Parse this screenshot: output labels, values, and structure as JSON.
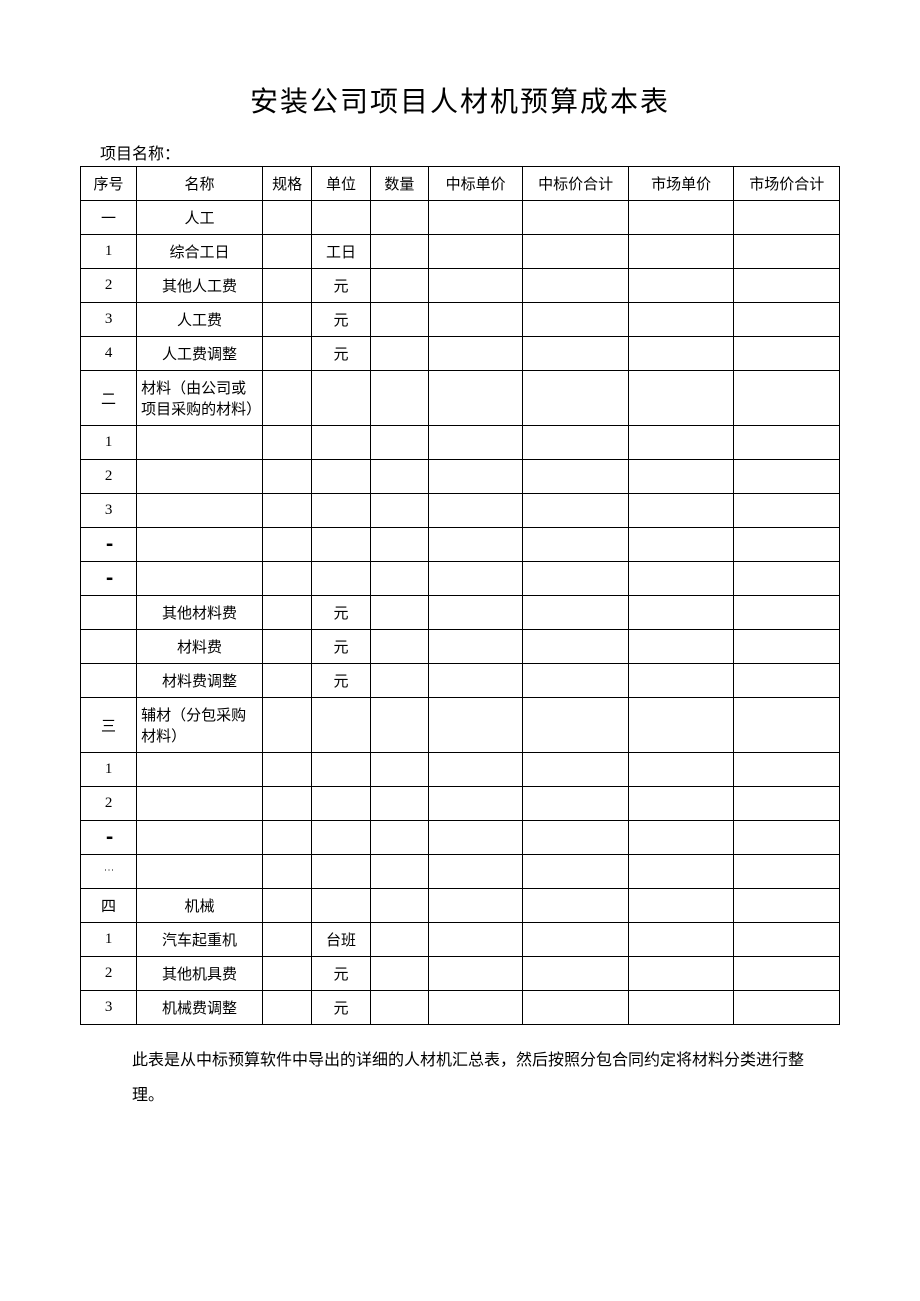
{
  "title": "安装公司项目人材机预算成本表",
  "project_label": "项目名称：",
  "headers": {
    "seq": "序号",
    "name": "名称",
    "spec": "规格",
    "unit": "单位",
    "qty": "数量",
    "bid_price": "中标单价",
    "bid_total": "中标价合计",
    "mkt_price": "市场单价",
    "mkt_total": "市场价合计"
  },
  "rows": [
    {
      "seq": "一",
      "name": "人工",
      "unit": ""
    },
    {
      "seq": "1",
      "name": "综合工日",
      "unit": "工日"
    },
    {
      "seq": "2",
      "name": "其他人工费",
      "unit": "元"
    },
    {
      "seq": "3",
      "name": "人工费",
      "unit": "元"
    },
    {
      "seq": "4",
      "name": "人工费调整",
      "unit": "元"
    },
    {
      "seq": "二",
      "name": "材料（由公司或项目采购的材料）",
      "unit": "",
      "align": "left"
    },
    {
      "seq": "1",
      "name": "",
      "unit": ""
    },
    {
      "seq": "2",
      "name": "",
      "unit": ""
    },
    {
      "seq": "3",
      "name": "",
      "unit": ""
    },
    {
      "seq": "…",
      "name": "",
      "unit": "",
      "vdots": true
    },
    {
      "seq": "…",
      "name": "",
      "unit": "",
      "vdots": true
    },
    {
      "seq": "",
      "name": "其他材料费",
      "unit": "元"
    },
    {
      "seq": "",
      "name": "材料费",
      "unit": "元"
    },
    {
      "seq": "",
      "name": "材料费调整",
      "unit": "元"
    },
    {
      "seq": "三",
      "name": "辅材（分包采购材料）",
      "unit": "",
      "align": "left"
    },
    {
      "seq": "1",
      "name": "",
      "unit": ""
    },
    {
      "seq": "2",
      "name": "",
      "unit": ""
    },
    {
      "seq": "…",
      "name": "",
      "unit": "",
      "vdots": true
    },
    {
      "seq": "⋮",
      "name": "",
      "unit": "",
      "dotcol": true
    },
    {
      "seq": "四",
      "name": "机械",
      "unit": ""
    },
    {
      "seq": "1",
      "name": "汽车起重机",
      "unit": "台班"
    },
    {
      "seq": "2",
      "name": "其他机具费",
      "unit": "元"
    },
    {
      "seq": "3",
      "name": "机械费调整",
      "unit": "元"
    }
  ],
  "footnote": "此表是从中标预算软件中导出的详细的人材机汇总表，然后按照分包合同约定将材料分类进行整理。"
}
